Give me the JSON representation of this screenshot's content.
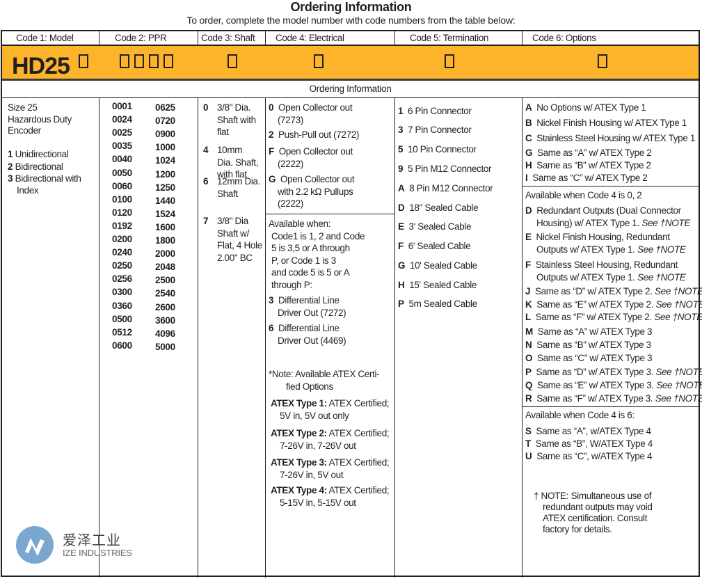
{
  "title": "Ordering Information",
  "subtitle": "To order, complete the model number with code numbers from the table below:",
  "headers": [
    "Code 1: Model",
    "Code 2: PPR",
    "Code 3: Shaft",
    "Code 4: Electrical",
    "Code 5: Termination",
    "Code 6: Options"
  ],
  "model_prefix": "HD25",
  "band_color": "#fdb42b",
  "sub_header": "Ordering Information",
  "model": {
    "desc": [
      "Size 25",
      "Hazardous Duty",
      "Encoder"
    ],
    "options": [
      {
        "code": "1",
        "label": "Unidirectional"
      },
      {
        "code": "2",
        "label": "Bidirectional"
      },
      {
        "code": "3",
        "label": "Bidirectional with",
        "cont": "Index"
      }
    ]
  },
  "ppr": {
    "col1": [
      "0001",
      "0024",
      "0025",
      "0035",
      "0040",
      "0050",
      "0060",
      "0100",
      "0120",
      "0192",
      "0200",
      "0240",
      "0250",
      "0256",
      "0300",
      "0360",
      "0500",
      "0512",
      "0600"
    ],
    "col2": [
      "0625",
      "0720",
      "0900",
      "1000",
      "1024",
      "1200",
      "1250",
      "1440",
      "1524",
      "1600",
      "1800",
      "2000",
      "2048",
      "2500",
      "2540",
      "2600",
      "3600",
      "4096",
      "5000"
    ]
  },
  "shaft": [
    {
      "code": "0",
      "lines": [
        "3/8\" Dia.",
        "Shaft with",
        "flat"
      ]
    },
    {
      "code": "4",
      "lines": [
        "10mm",
        "Dia. Shaft,",
        "with flat"
      ]
    },
    {
      "code": "6",
      "lines": [
        "12mm Dia.",
        "Shaft"
      ]
    },
    {
      "code": "7",
      "lines": [
        "3/8\" Dia",
        "Shaft w/",
        "Flat, 4 Hole",
        "2.00\" BC"
      ]
    }
  ],
  "electrical": {
    "items": [
      {
        "code": "0",
        "lines": [
          "Open Collector out",
          "(7273)"
        ]
      },
      {
        "code": "2",
        "lines": [
          "Push-Pull out (7272)"
        ]
      },
      {
        "code": "F",
        "lines": [
          "Open Collector out",
          "(2222)"
        ]
      },
      {
        "code": "G",
        "lines": [
          "Open Collector out",
          "with 2.2 kΩ Pullups",
          "(2222)"
        ]
      }
    ],
    "condition": [
      "Available when:",
      "Code1 is 1, 2 and Code",
      "5 is 3,5 or A through",
      "P, or Code 1 is 3",
      "and code 5 is 5 or A",
      "through P:"
    ],
    "conditional_items": [
      {
        "code": "3",
        "lines": [
          "Differential Line",
          "Driver Out (7272)"
        ]
      },
      {
        "code": "6",
        "lines": [
          "Differential Line",
          "Driver Out (4469)"
        ]
      }
    ],
    "note": [
      "*Note: Available ATEX Certi-",
      "fied Options"
    ],
    "atex": [
      {
        "label": "ATEX Type 1:",
        "text": "ATEX Certified;",
        "detail": "5V in, 5V out only"
      },
      {
        "label": "ATEX Type 2:",
        "text": "ATEX Certified;",
        "detail": "7-26V in, 7-26V out"
      },
      {
        "label": "ATEX Type 3:",
        "text": "ATEX Certified;",
        "detail": "7-26V in, 5V out"
      },
      {
        "label": "ATEX Type 4:",
        "text": "ATEX Certified;",
        "detail": "5-15V in, 5-15V out"
      }
    ]
  },
  "termination": [
    {
      "code": "1",
      "label": "6 Pin Connector"
    },
    {
      "code": "3",
      "label": "7 Pin Connector"
    },
    {
      "code": "5",
      "label": "10 Pin Connector"
    },
    {
      "code": "9",
      "label": "5 Pin M12 Connector"
    },
    {
      "code": "A",
      "label": "8 Pin M12 Connector"
    },
    {
      "code": "D",
      "label": "18\" Sealed Cable"
    },
    {
      "code": "E",
      "label": "3' Sealed Cable"
    },
    {
      "code": "F",
      "label": "6' Sealed Cable"
    },
    {
      "code": "G",
      "label": "10' Sealed Cable"
    },
    {
      "code": "H",
      "label": "15' Sealed Cable"
    },
    {
      "code": "P",
      "label": "5m Sealed Cable"
    }
  ],
  "options": {
    "group1": [
      {
        "code": "A",
        "label": "No Options w/ ATEX Type 1"
      },
      {
        "code": "B",
        "label": "Nickel Finish Housing w/ ATEX Type 1"
      },
      {
        "code": "C",
        "label": "Stainless Steel Housing w/ ATEX Type 1"
      },
      {
        "code": "G",
        "label": "Same as “A” w/ ATEX Type 2"
      },
      {
        "code": "H",
        "label": "Same as “B” w/ ATEX Type 2"
      },
      {
        "code": "I",
        "label": "Same as “C” w/ ATEX Type 2"
      }
    ],
    "group2_title": "Available when Code 4 is 0, 2",
    "group2": [
      {
        "code": "D",
        "l1": "Redundant Outputs (Dual Connector",
        "l2": "Housing) w/ ATEX Type 1.",
        "see": "See †NOTE"
      },
      {
        "code": "E",
        "l1": "Nickel Finish Housing, Redundant",
        "l2": "Outputs  w/ ATEX Type 1.",
        "see": "See †NOTE"
      },
      {
        "code": "F",
        "l1": "Stainless Steel Housing, Redundant",
        "l2": "Outputs w/ ATEX Type 1.",
        "see": "See †NOTE"
      },
      {
        "code": "J",
        "l1": "Same as “D” w/ ATEX Type 2.",
        "see": "See †NOTE"
      },
      {
        "code": "K",
        "l1": "Same as “E” w/ ATEX Type 2.",
        "see": "See †NOTE"
      },
      {
        "code": "L",
        "l1": "Same as “F” w/ ATEX Type 2.",
        "see": "See †NOTE"
      },
      {
        "code": "M",
        "l1": "Same as “A” w/ ATEX Type 3"
      },
      {
        "code": "N",
        "l1": "Same as “B” w/ ATEX Type 3"
      },
      {
        "code": "O",
        "l1": "Same as “C” w/ ATEX Type 3"
      },
      {
        "code": "P",
        "l1": "Same as “D” w/ ATEX Type 3.",
        "see": "See †NOTE"
      },
      {
        "code": "Q",
        "l1": "Same as “E” w/ ATEX Type 3.",
        "see": "See †NOTE"
      },
      {
        "code": "R",
        "l1": "Same as “F” w/ ATEX Type 3.",
        "see": "See †NOTE"
      }
    ],
    "group3_title": "Available when Code 4 is 6:",
    "group3": [
      {
        "code": "S",
        "label": "Same as “A”, w/ATEX Type 4"
      },
      {
        "code": "T",
        "label": "Same as “B”, W/ATEX Type 4"
      },
      {
        "code": "U",
        "label": "Same as “C”, w/ATEX Type 4"
      }
    ],
    "footnote": [
      "† NOTE: Simultaneous use of",
      "redundant outputs may void",
      "ATEX certification. Consult",
      "factory for details."
    ]
  },
  "watermark": {
    "cn": "爱泽工业",
    "en": "IZE INDUSTRIES",
    "color": "#7aa7d0"
  }
}
